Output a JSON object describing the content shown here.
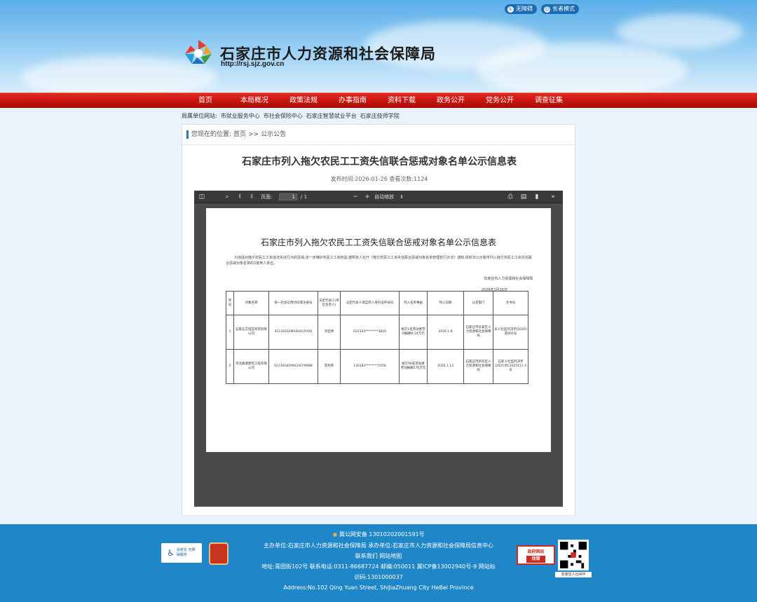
{
  "accessibility": {
    "barrier_free": "无障碍",
    "elder_mode": "长者模式"
  },
  "header": {
    "site_name": "石家庄市人力资源和社会保障局",
    "site_url": "http://rsj.sjz.gov.cn"
  },
  "nav": [
    "首页",
    "本局概况",
    "政策法规",
    "办事指南",
    "资料下载",
    "政务公开",
    "党务公开",
    "调查征集"
  ],
  "sublinks": {
    "label": "局属单位网站:",
    "items": [
      "市就业服务中心",
      "市社会保险中心",
      "石家庄智慧就业平台",
      "石家庄技师学院"
    ]
  },
  "breadcrumb": {
    "prefix": "您现在的位置:",
    "home": "首页",
    "sep": ">>",
    "current": "公示公告"
  },
  "article": {
    "title": "石家庄市列入拖欠农民工工资失信联合惩戒对象名单公示信息表",
    "meta": "发布时间:2026-01-26 查看次数:1124"
  },
  "viewer": {
    "page_label": "页面:",
    "page_current": "1",
    "page_total": "/ 1",
    "zoom_label": "自动缩放"
  },
  "doc": {
    "title": "石家庄市列入拖欠农民工工资失信联合惩戒对象名单公示信息表",
    "body": "为加强对拖欠农民工工资违法失信行为的惩戒,进一步维护农民工工资权益,按照省人社厅《拖欠农民工工资失信联合惩戒对象名单管理暂行办法》通知,现依法公示我市列入拖欠农民工工资失信联合惩戒对象名单的2家用人单位。",
    "sign_org": "石家庄市人力资源和社会保障局",
    "sign_date": "2026年1月26日",
    "headers": [
      "序号",
      "对象名称",
      "统一社会信用代码或注册号",
      "法定代表人(单位负责人)",
      "法定代表人或自然人身份证件号码",
      "列入名单事由",
      "列入日期",
      "认定部门",
      "文书号"
    ],
    "rows": [
      [
        "1",
        "石家庄艾怪宜商贸有限公司",
        "91130102MA0GHLTU0X",
        "刘亚倩",
        "622103********3819",
        "拖欠1名劳动者劳动报酬4.24万元",
        "2026.1.8",
        "石家庄市长安区人力资源和社会保障局",
        "长人社监列决字[2026]第001号"
      ],
      [
        "2",
        "河北嵘源建筑工程有限公司",
        "91130181MACHEYXM8B",
        "李珂英",
        "130183********1056",
        "拖欠90名劳动者劳动报酬176万元",
        "2026.1.13",
        "石家庄市新华区人力资源和社会保障局",
        "石新人社监列决字[2025]RC2025111 4号"
      ]
    ]
  },
  "footer": {
    "police": "冀公网安备 13010202001591号",
    "host": "主办单位:石家庄市人力资源和社会保障局 承办单位:石家庄市人力资源和社会保障局信息中心",
    "links": "联系我们 网站地图",
    "contact": "地址:青园街102号 联系电话:0311-86687724 邮编:050011 冀ICP备13002940号-9 网站标",
    "code": "识码:1301000037",
    "address_en": "Address:No.102 Qing Yuan Street, ShiJiaZhuang City HeBei Province",
    "badge_left": "适老化 无障碍服务",
    "gov_badge_1": "政府网站",
    "gov_badge_2": "找错",
    "qr_caption": "石家庄人社APP"
  }
}
